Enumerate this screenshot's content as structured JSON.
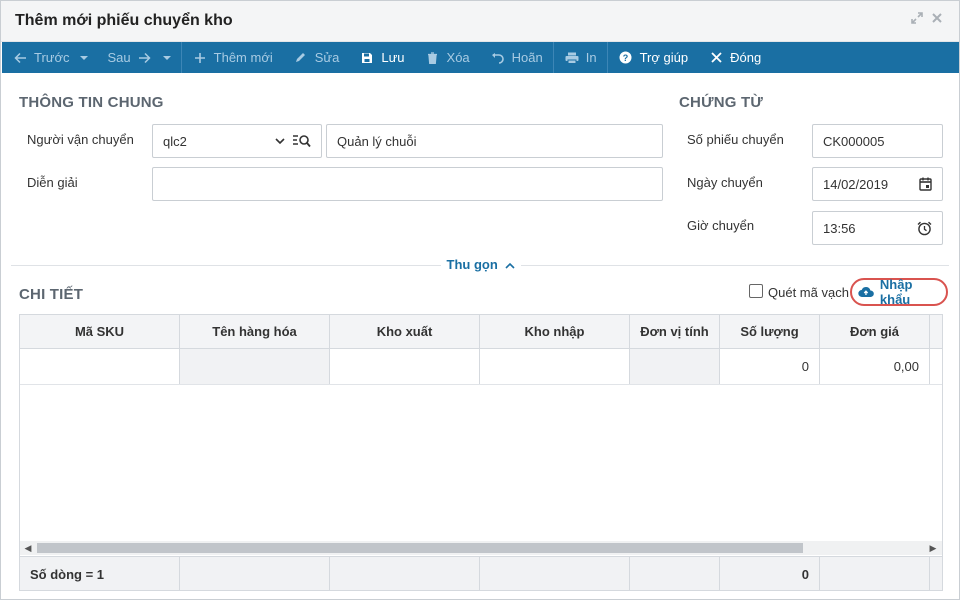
{
  "window": {
    "title": "Thêm mới phiếu chuyển kho"
  },
  "toolbar": {
    "prev": "Trước",
    "next": "Sau",
    "add": "Thêm mới",
    "edit": "Sửa",
    "save": "Lưu",
    "delete": "Xóa",
    "undo": "Hoãn",
    "print": "In",
    "help": "Trợ giúp",
    "close": "Đóng"
  },
  "general": {
    "heading": "THÔNG TIN CHUNG",
    "carrier_label": "Người vận chuyển",
    "carrier_code": "qlc2",
    "carrier_name": "Quản lý chuỗi",
    "description_label": "Diễn giải",
    "description_value": ""
  },
  "document": {
    "heading": "CHỨNG TỪ",
    "number_label": "Số phiếu chuyển",
    "number_value": "CK000005",
    "date_label": "Ngày chuyển",
    "date_value": "14/02/2019",
    "time_label": "Giờ chuyển",
    "time_value": "13:56"
  },
  "collapse_label": "Thu gọn",
  "detail": {
    "heading": "CHI TIẾT",
    "barcode_label": "Quét mã vạch",
    "import_label": "Nhập khẩu",
    "columns": [
      "Mã SKU",
      "Tên hàng hóa",
      "Kho xuất",
      "Kho nhập",
      "Đơn vị tính",
      "Số lượng",
      "Đơn giá"
    ],
    "rows": [
      {
        "sku": "",
        "name": "",
        "from": "",
        "to": "",
        "unit": "",
        "qty": "0",
        "price": "0,00"
      }
    ],
    "footer_count": "Số dòng = 1",
    "footer_qty": "0"
  },
  "colors": {
    "toolbar_bg": "#1a6fa3",
    "accent": "#1a6fa3",
    "highlight_ring": "#d9534f"
  }
}
